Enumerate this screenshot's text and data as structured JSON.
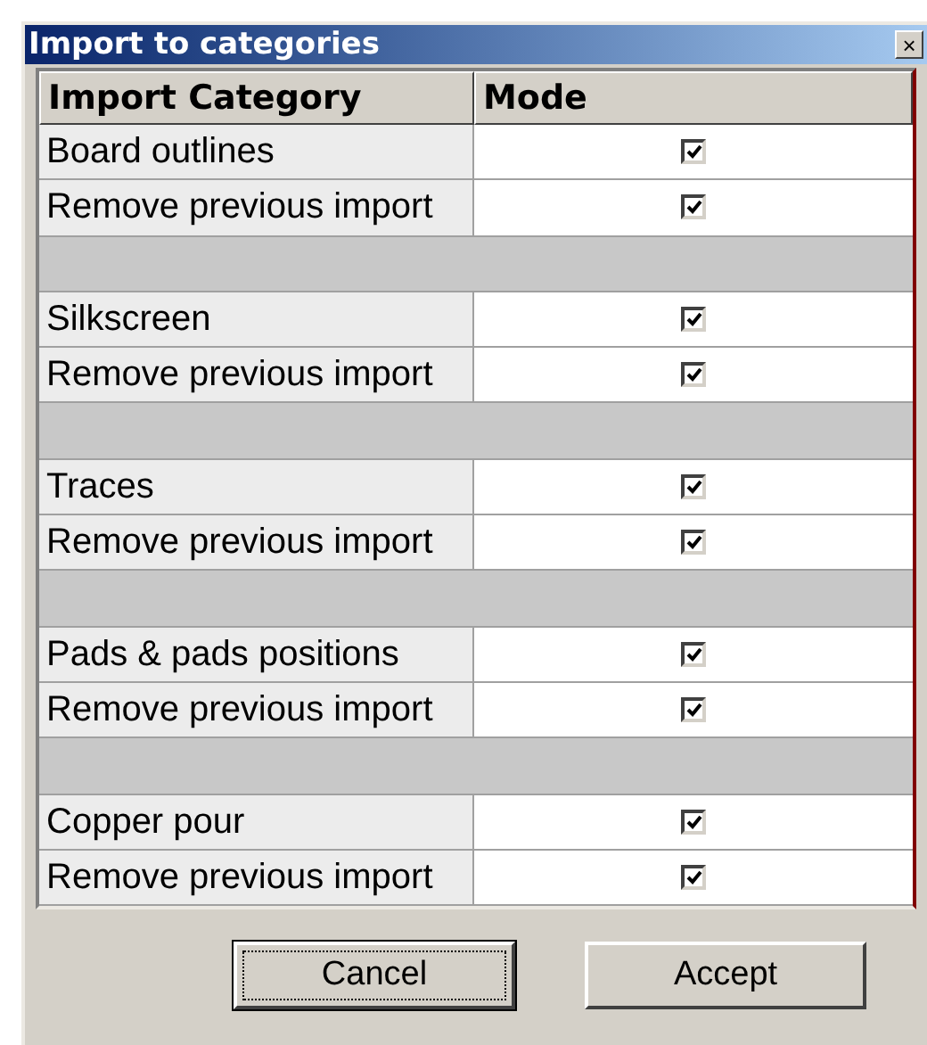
{
  "window": {
    "title": "Import to categories",
    "close": "×"
  },
  "table": {
    "columns": [
      "Import Category",
      "Mode"
    ],
    "rows": [
      {
        "kind": "item",
        "label": "Board outlines",
        "checked": true
      },
      {
        "kind": "item",
        "label": "Remove previous import",
        "checked": true
      },
      {
        "kind": "separator"
      },
      {
        "kind": "item",
        "label": "Silkscreen",
        "checked": true
      },
      {
        "kind": "item",
        "label": "Remove previous import",
        "checked": true
      },
      {
        "kind": "separator"
      },
      {
        "kind": "item",
        "label": "Traces",
        "checked": true
      },
      {
        "kind": "item",
        "label": "Remove previous import",
        "checked": true
      },
      {
        "kind": "separator"
      },
      {
        "kind": "item",
        "label": "Pads & pads positions",
        "checked": true
      },
      {
        "kind": "item",
        "label": "Remove previous import",
        "checked": true
      },
      {
        "kind": "separator"
      },
      {
        "kind": "item",
        "label": "Copper pour",
        "checked": true
      },
      {
        "kind": "item",
        "label": "Remove previous import",
        "checked": true
      }
    ]
  },
  "buttons": [
    {
      "label": "Cancel",
      "focused": true
    },
    {
      "label": "Accept",
      "focused": false
    }
  ]
}
